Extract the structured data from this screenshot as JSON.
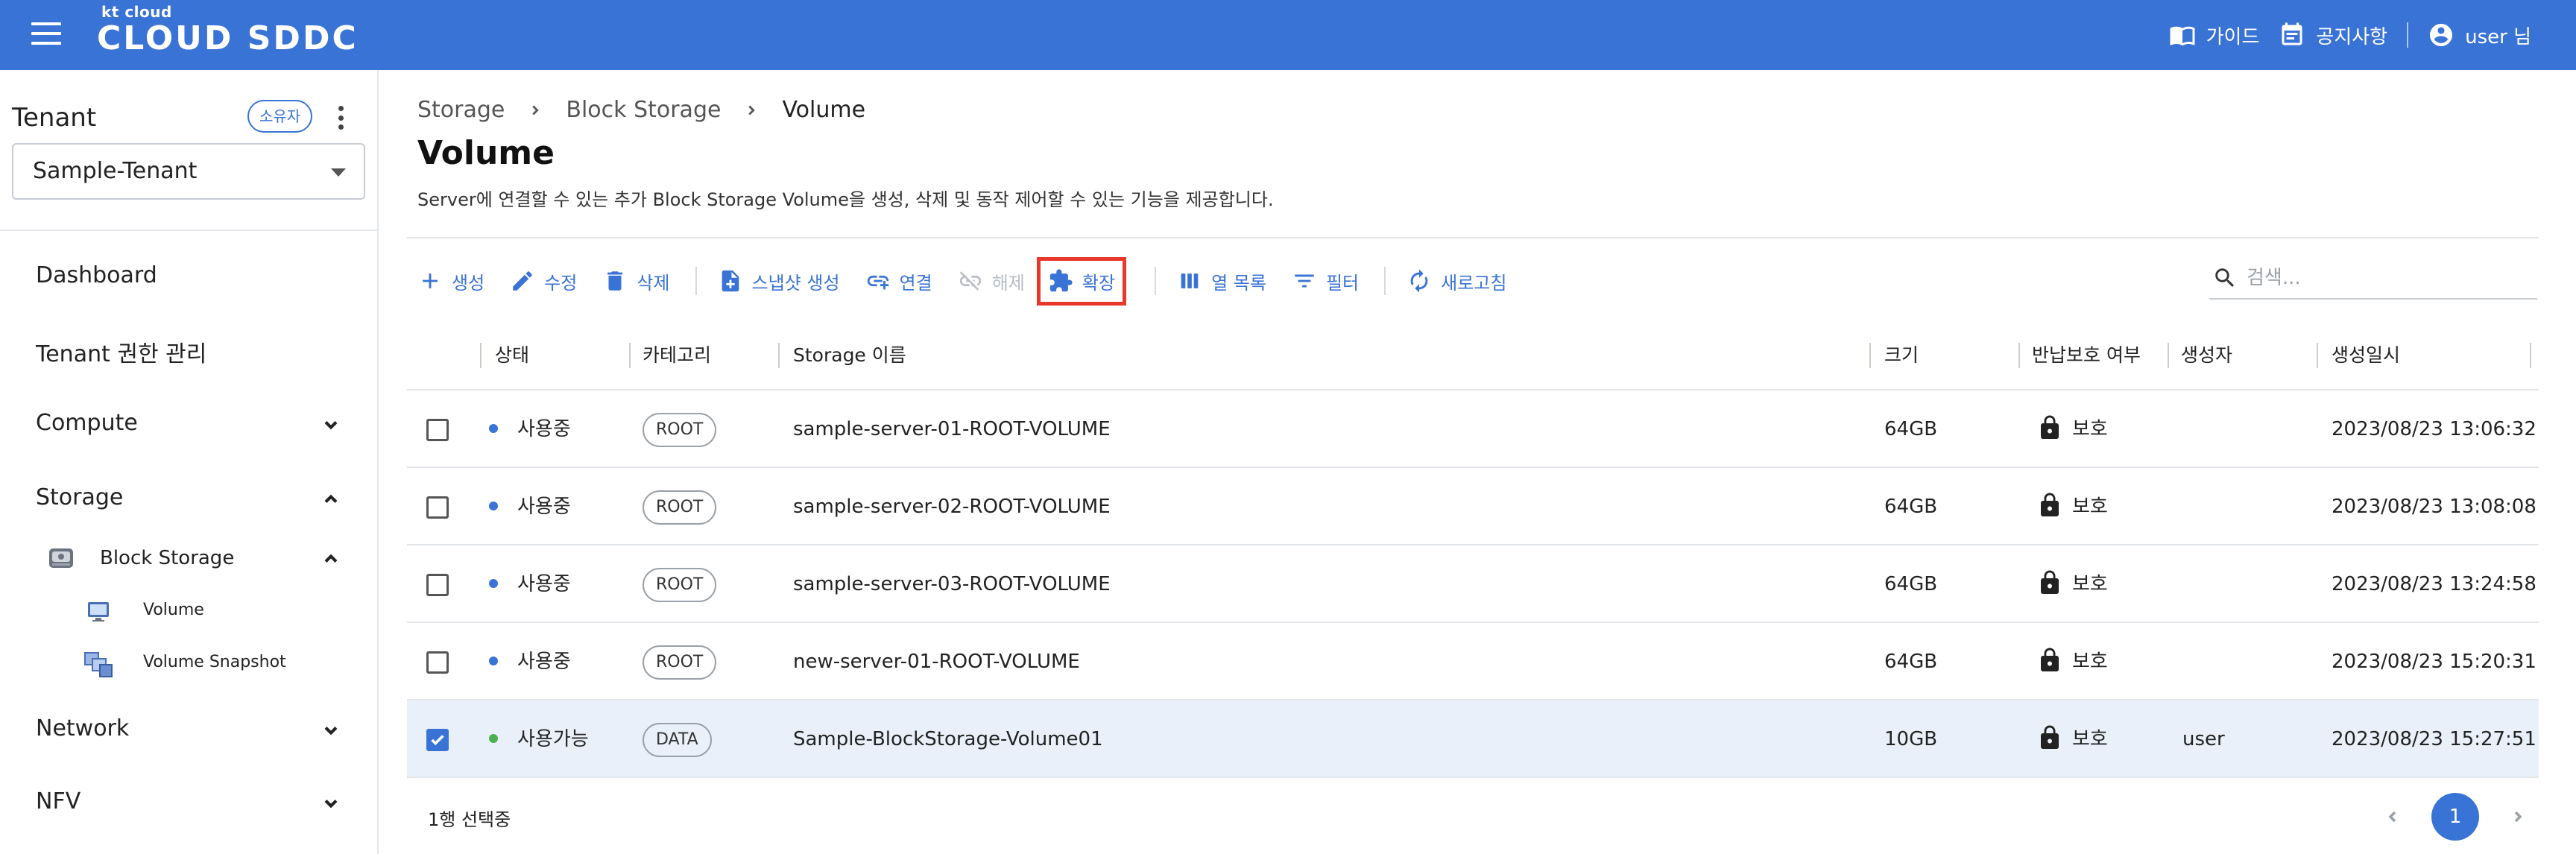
{
  "header": {
    "brand_top": "kt cloud",
    "brand_main": "CLOUD SDDC",
    "guide": "가이드",
    "notice": "공지사항",
    "user": "user 님"
  },
  "sidebar": {
    "tenant_title": "Tenant",
    "owner_badge": "소유자",
    "tenant_selected": "Sample-Tenant",
    "nav": {
      "dashboard": "Dashboard",
      "tenant_admin": "Tenant 권한 관리",
      "compute": "Compute",
      "storage": "Storage",
      "block_storage": "Block Storage",
      "volume": "Volume",
      "volume_snapshot": "Volume Snapshot",
      "network": "Network",
      "nfv": "NFV"
    }
  },
  "main": {
    "breadcrumb": [
      "Storage",
      "Block Storage",
      "Volume"
    ],
    "title": "Volume",
    "description": "Server에 연결할 수 있는 추가 Block Storage Volume을 생성, 삭제 및 동작 제어할 수 있는 기능을 제공합니다."
  },
  "toolbar": {
    "create": "생성",
    "edit": "수정",
    "delete": "삭제",
    "snapshot": "스냅샷 생성",
    "connect": "연결",
    "disconnect": "해제",
    "extend": "확장",
    "columns": "열 목록",
    "filter": "필터",
    "refresh": "새로고침",
    "search_placeholder": "검색..."
  },
  "table": {
    "columns": [
      "상태",
      "카테고리",
      "Storage 이름",
      "크기",
      "반납보호 여부",
      "생성자",
      "생성일시"
    ],
    "rows": [
      {
        "checked": false,
        "status": "사용중",
        "status_color": "#3a73d6",
        "category": "ROOT",
        "name": "sample-server-01-ROOT-VOLUME",
        "size": "64GB",
        "protect": "보호",
        "creator": "",
        "created": "2023/08/23 13:06:32"
      },
      {
        "checked": false,
        "status": "사용중",
        "status_color": "#3a73d6",
        "category": "ROOT",
        "name": "sample-server-02-ROOT-VOLUME",
        "size": "64GB",
        "protect": "보호",
        "creator": "",
        "created": "2023/08/23 13:08:08"
      },
      {
        "checked": false,
        "status": "사용중",
        "status_color": "#3a73d6",
        "category": "ROOT",
        "name": "sample-server-03-ROOT-VOLUME",
        "size": "64GB",
        "protect": "보호",
        "creator": "",
        "created": "2023/08/23 13:24:58"
      },
      {
        "checked": false,
        "status": "사용중",
        "status_color": "#3a73d6",
        "category": "ROOT",
        "name": "new-server-01-ROOT-VOLUME",
        "size": "64GB",
        "protect": "보호",
        "creator": "",
        "created": "2023/08/23 15:20:31"
      },
      {
        "checked": true,
        "status": "사용가능",
        "status_color": "#4caf50",
        "category": "DATA",
        "name": "Sample-BlockStorage-Volume01",
        "size": "10GB",
        "protect": "보호",
        "creator": "user",
        "created": "2023/08/23 15:27:51"
      }
    ]
  },
  "footer": {
    "selected_text": "1행 선택중",
    "current_page": "1"
  },
  "colors": {
    "primary": "#3a73d6",
    "highlight": "#e8382a"
  }
}
